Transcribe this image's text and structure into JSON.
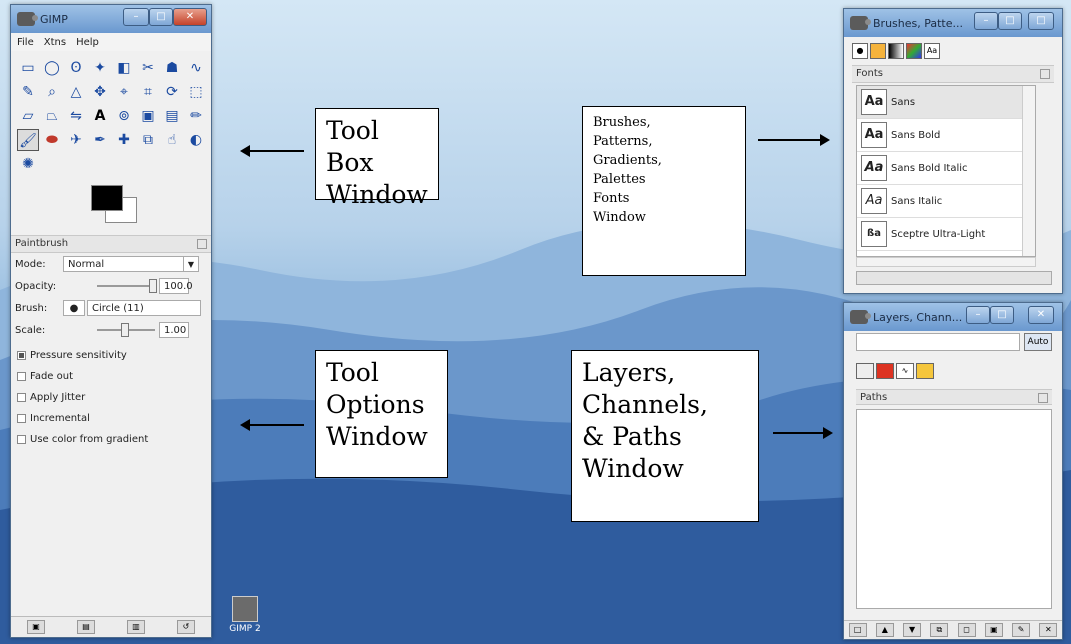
{
  "desktop": {
    "icon_label": "GIMP 2"
  },
  "toolbox": {
    "title": "GIMP",
    "menu": [
      "File",
      "Xtns",
      "Help"
    ],
    "tools": [
      "rect-select",
      "ellipse-select",
      "free-select",
      "fuzzy-select",
      "select-by-color",
      "scissors",
      "foreground-select",
      "paths",
      "color-picker",
      "zoom",
      "measure",
      "move",
      "align",
      "crop",
      "rotate",
      "scale",
      "shear",
      "perspective",
      "flip",
      "text",
      "clone",
      "bucket-fill",
      "blend",
      "pencil",
      "paintbrush",
      "eraser",
      "airbrush",
      "ink",
      "heal",
      "perspective-clone",
      "smudge",
      "dodge-burn",
      "blur"
    ],
    "foreground_color": "#000000",
    "background_color": "#ffffff",
    "options_title": "Paintbrush",
    "mode_label": "Mode:",
    "mode_value": "Normal",
    "opacity_label": "Opacity:",
    "opacity_value": "100.0",
    "brush_label": "Brush:",
    "brush_value": "Circle (11)",
    "scale_label": "Scale:",
    "scale_value": "1.00",
    "checks": [
      {
        "label": "Pressure sensitivity",
        "checked": true
      },
      {
        "label": "Fade out",
        "checked": false
      },
      {
        "label": "Apply Jitter",
        "checked": false
      },
      {
        "label": "Incremental",
        "checked": false
      },
      {
        "label": "Use color from gradient",
        "checked": false
      }
    ]
  },
  "brushes": {
    "title": "Brushes, Patte...",
    "panel_label": "Fonts",
    "fonts": [
      "Sans",
      "Sans Bold",
      "Sans Bold Italic",
      "Sans Italic",
      "Sceptre Ultra-Light"
    ]
  },
  "layers": {
    "title": "Layers, Chann...",
    "auto_label": "Auto",
    "panel_label": "Paths"
  },
  "callouts": {
    "toolbox": [
      "Tool Box",
      "Window"
    ],
    "tool_options": [
      "Tool",
      "Options",
      "Window"
    ],
    "brushes": [
      "Brushes,",
      "Patterns,",
      "Gradients,",
      "Palettes",
      "Fonts",
      "Window"
    ],
    "layers": [
      "Layers,",
      "Channels,",
      "& Paths",
      "Window"
    ]
  }
}
